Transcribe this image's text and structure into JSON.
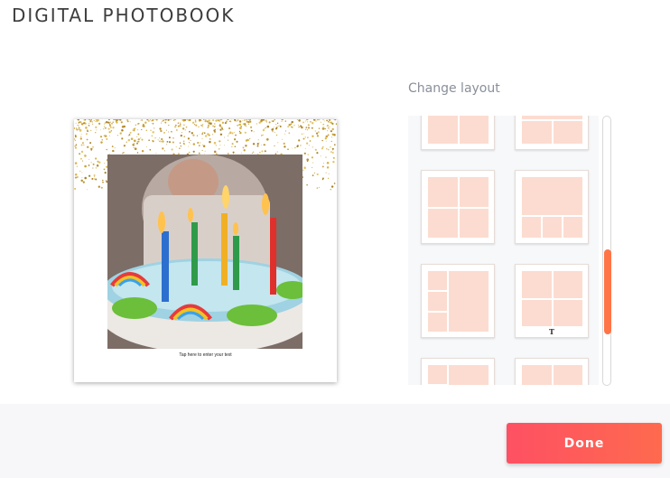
{
  "header": {
    "title": "DIGITAL PHOTOBOOK"
  },
  "page": {
    "caption_placeholder": "Tap here to enter your text"
  },
  "layouts": {
    "label": "Change layout",
    "text_marker": "T"
  },
  "footer": {
    "done_label": "Done"
  },
  "colors": {
    "accent": "#ff7548",
    "cell": "#fcdcd0",
    "done_start": "#fe5063",
    "done_end": "#fe6a4e"
  }
}
